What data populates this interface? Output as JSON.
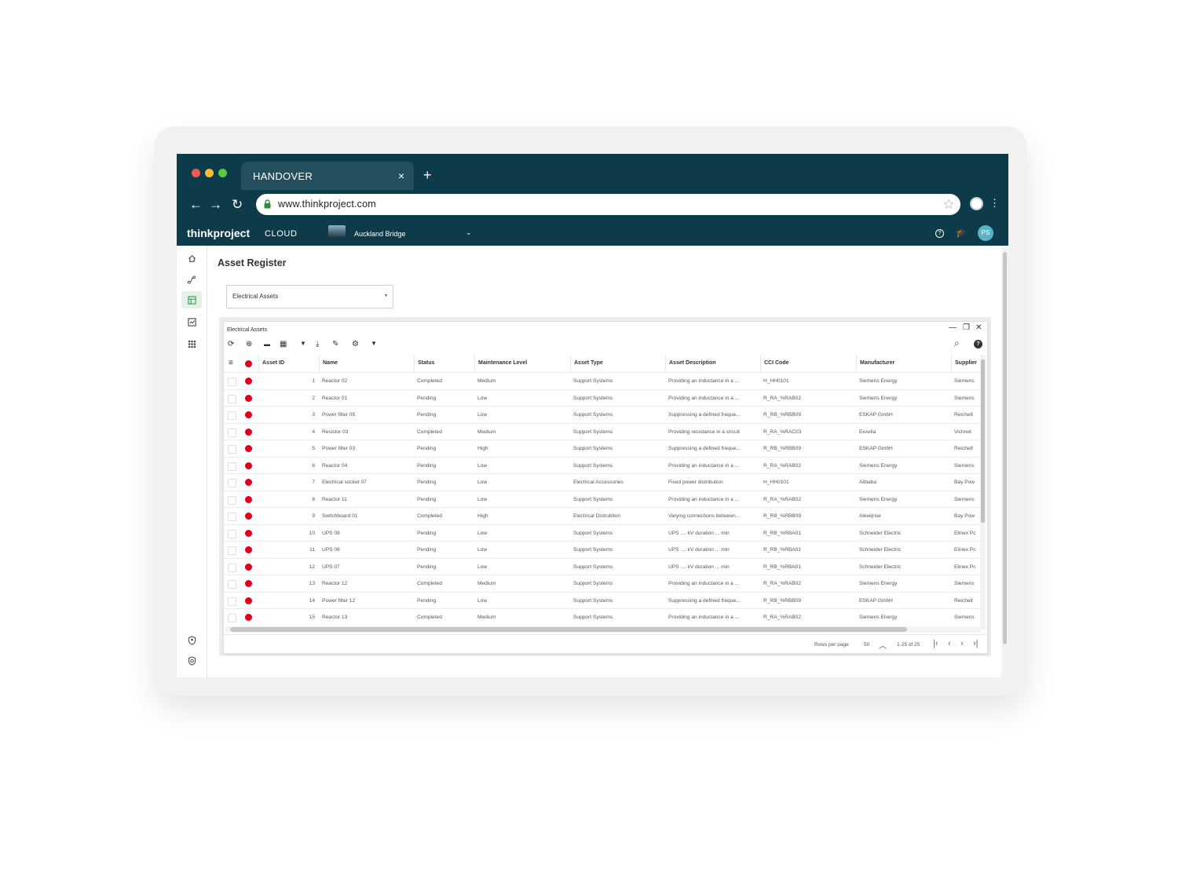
{
  "browser": {
    "tab_title": "HANDOVER",
    "tab_close": "×",
    "new_tab": "+",
    "url": "www.thinkproject.com",
    "back": "←",
    "forward": "→",
    "reload": "↻",
    "menu_dots": "⋮",
    "traffic_colors": [
      "#ee5a52",
      "#f5bd2f",
      "#5ec942"
    ]
  },
  "app": {
    "brand": "thinkproject",
    "brand_suffix": "CLOUD",
    "project": "Auckland Bridge",
    "avatar": "PS",
    "help_icon": "?",
    "learn_icon": "🎓",
    "caret": "⌄"
  },
  "sidebar_icons": [
    "home-icon",
    "route-icon",
    "table-icon",
    "chart-icon",
    "apps-icon",
    "user-shield-icon",
    "shield-icon"
  ],
  "page": {
    "title": "Asset Register",
    "dropdown_value": "Electrical Assets",
    "dropdown_caret": "▾"
  },
  "panel": {
    "title": "Electrical Assets",
    "minimize": "—",
    "restore": "❐",
    "close": "✕"
  },
  "toolbar": {
    "refresh": "⟳",
    "add": "⊕",
    "row_view": "▬",
    "grid_view": "▦",
    "filter": "▼",
    "download": "⤓",
    "edit": "✎",
    "settings": "⚙",
    "more": "▼",
    "search": "⌕",
    "help": "?"
  },
  "table": {
    "menu_icon": "≡",
    "columns": [
      "Asset ID",
      "Name",
      "Status",
      "Maintenance Level",
      "Asset Type",
      "Asset Description",
      "CCI Code",
      "Manufacturer",
      "Supplier"
    ],
    "rows": [
      [
        "1",
        "Reactor 02",
        "Completed",
        "Medium",
        "Support Systems",
        "Providing an inductance in a ...",
        "H_HH0101",
        "Siemens Energy",
        "Siemens"
      ],
      [
        "2",
        "Reactor 01",
        "Pending",
        "Low",
        "Support Systems",
        "Providing an inductance in a ...",
        "R_RA_%RAB02",
        "Siemens Energy",
        "Siemens"
      ],
      [
        "3",
        "Power filter 05",
        "Pending",
        "Low",
        "Support Systems",
        "Suppressing a defined freque...",
        "R_RB_%RBB09",
        "ESKAP GmbH",
        "Reichelt"
      ],
      [
        "4",
        "Resistor 03",
        "Completed",
        "Medium",
        "Support Systems",
        "Providing resistance in a circuit",
        "R_RA_%RAC03",
        "Exxelia",
        "Vichnet"
      ],
      [
        "5",
        "Power filter 03",
        "Pending",
        "High",
        "Support Systems",
        "Suppressing a defined freque...",
        "R_RB_%RBB09",
        "ESKAP GmbH",
        "Reichelt"
      ],
      [
        "6",
        "Reactor 04",
        "Pending",
        "Low",
        "Support Systems",
        "Providing an inductance in a ...",
        "R_RA_%RAB02",
        "Siemens Energy",
        "Siemens"
      ],
      [
        "7",
        "Electrical socket 07",
        "Pending",
        "Low",
        "Electrical Accessories",
        "Fixed power distribution",
        "H_HH0101",
        "Alibaba",
        "Bay Pow"
      ],
      [
        "8",
        "Reactor 11",
        "Pending",
        "Low",
        "Support Systems",
        "Providing an inductance in a ...",
        "R_RA_%RAB02",
        "Siemens Energy",
        "Siemens"
      ],
      [
        "9",
        "Switchboard 01",
        "Completed",
        "High",
        "Electrical Distrubtion",
        "Varying connections between...",
        "R_RB_%RBB09",
        "Alewijnse",
        "Bay Pow"
      ],
      [
        "10",
        "UPS 09",
        "Pending",
        "Low",
        "Support Systems",
        "UPS .... kV duration ... min",
        "R_RB_%RBA01",
        "Schneider Electric",
        "Elinex Pc"
      ],
      [
        "11",
        "UPS 08",
        "Pending",
        "Low",
        "Support Systems",
        "UPS .... kV duration ... min",
        "R_RB_%RBA01",
        "Schneider Electric",
        "Elinex Pc"
      ],
      [
        "12",
        "UPS 07",
        "Pending",
        "Low",
        "Support Systems",
        "UPS .... kV duration ... min",
        "R_RB_%RBA01",
        "Schneider Electric",
        "Elinex Pc"
      ],
      [
        "13",
        "Reactor 12",
        "Completed",
        "Medium",
        "Support Systems",
        "Providing an inductance in a ...",
        "R_RA_%RAB02",
        "Siemens Energy",
        "Siemens"
      ],
      [
        "14",
        "Power filter 12",
        "Pending",
        "Low",
        "Support Systems",
        "Suppressing a defined freque...",
        "R_RB_%RBB09",
        "ESKAP GmbH",
        "Reichelt"
      ],
      [
        "15",
        "Reactor 13",
        "Completed",
        "Medium",
        "Support Systems",
        "Providing an inductance in a ...",
        "R_RA_%RAB02",
        "Siemens Energy",
        "Siemens"
      ]
    ]
  },
  "footer": {
    "rows_per_page_label": "Rows per page",
    "rows_per_page": "50",
    "range": "1-25 of 25",
    "first": "|‹",
    "prev": "‹",
    "next": "›",
    "last": "›|",
    "expand": "︿"
  }
}
